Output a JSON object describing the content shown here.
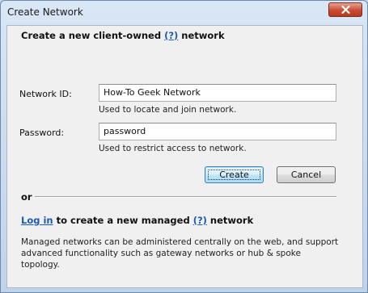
{
  "window": {
    "title": "Create Network"
  },
  "client_owned": {
    "heading_prefix": "Create a new client-owned",
    "help_label": "(?)",
    "heading_suffix": "network"
  },
  "fields": {
    "network_id": {
      "label": "Network ID:",
      "value": "How-To Geek Network",
      "hint": "Used to locate and join network."
    },
    "password": {
      "label": "Password:",
      "value": "password",
      "hint": "Used to restrict access to network."
    }
  },
  "buttons": {
    "create": "Create",
    "cancel": "Cancel"
  },
  "or_label": "or",
  "managed": {
    "login_link": "Log in",
    "middle_text": "to create a new managed",
    "help_label": "(?)",
    "suffix": "network",
    "description": "Managed networks can be administered centrally on the web, and support advanced functionality such as gateway networks or hub & spoke topology."
  }
}
